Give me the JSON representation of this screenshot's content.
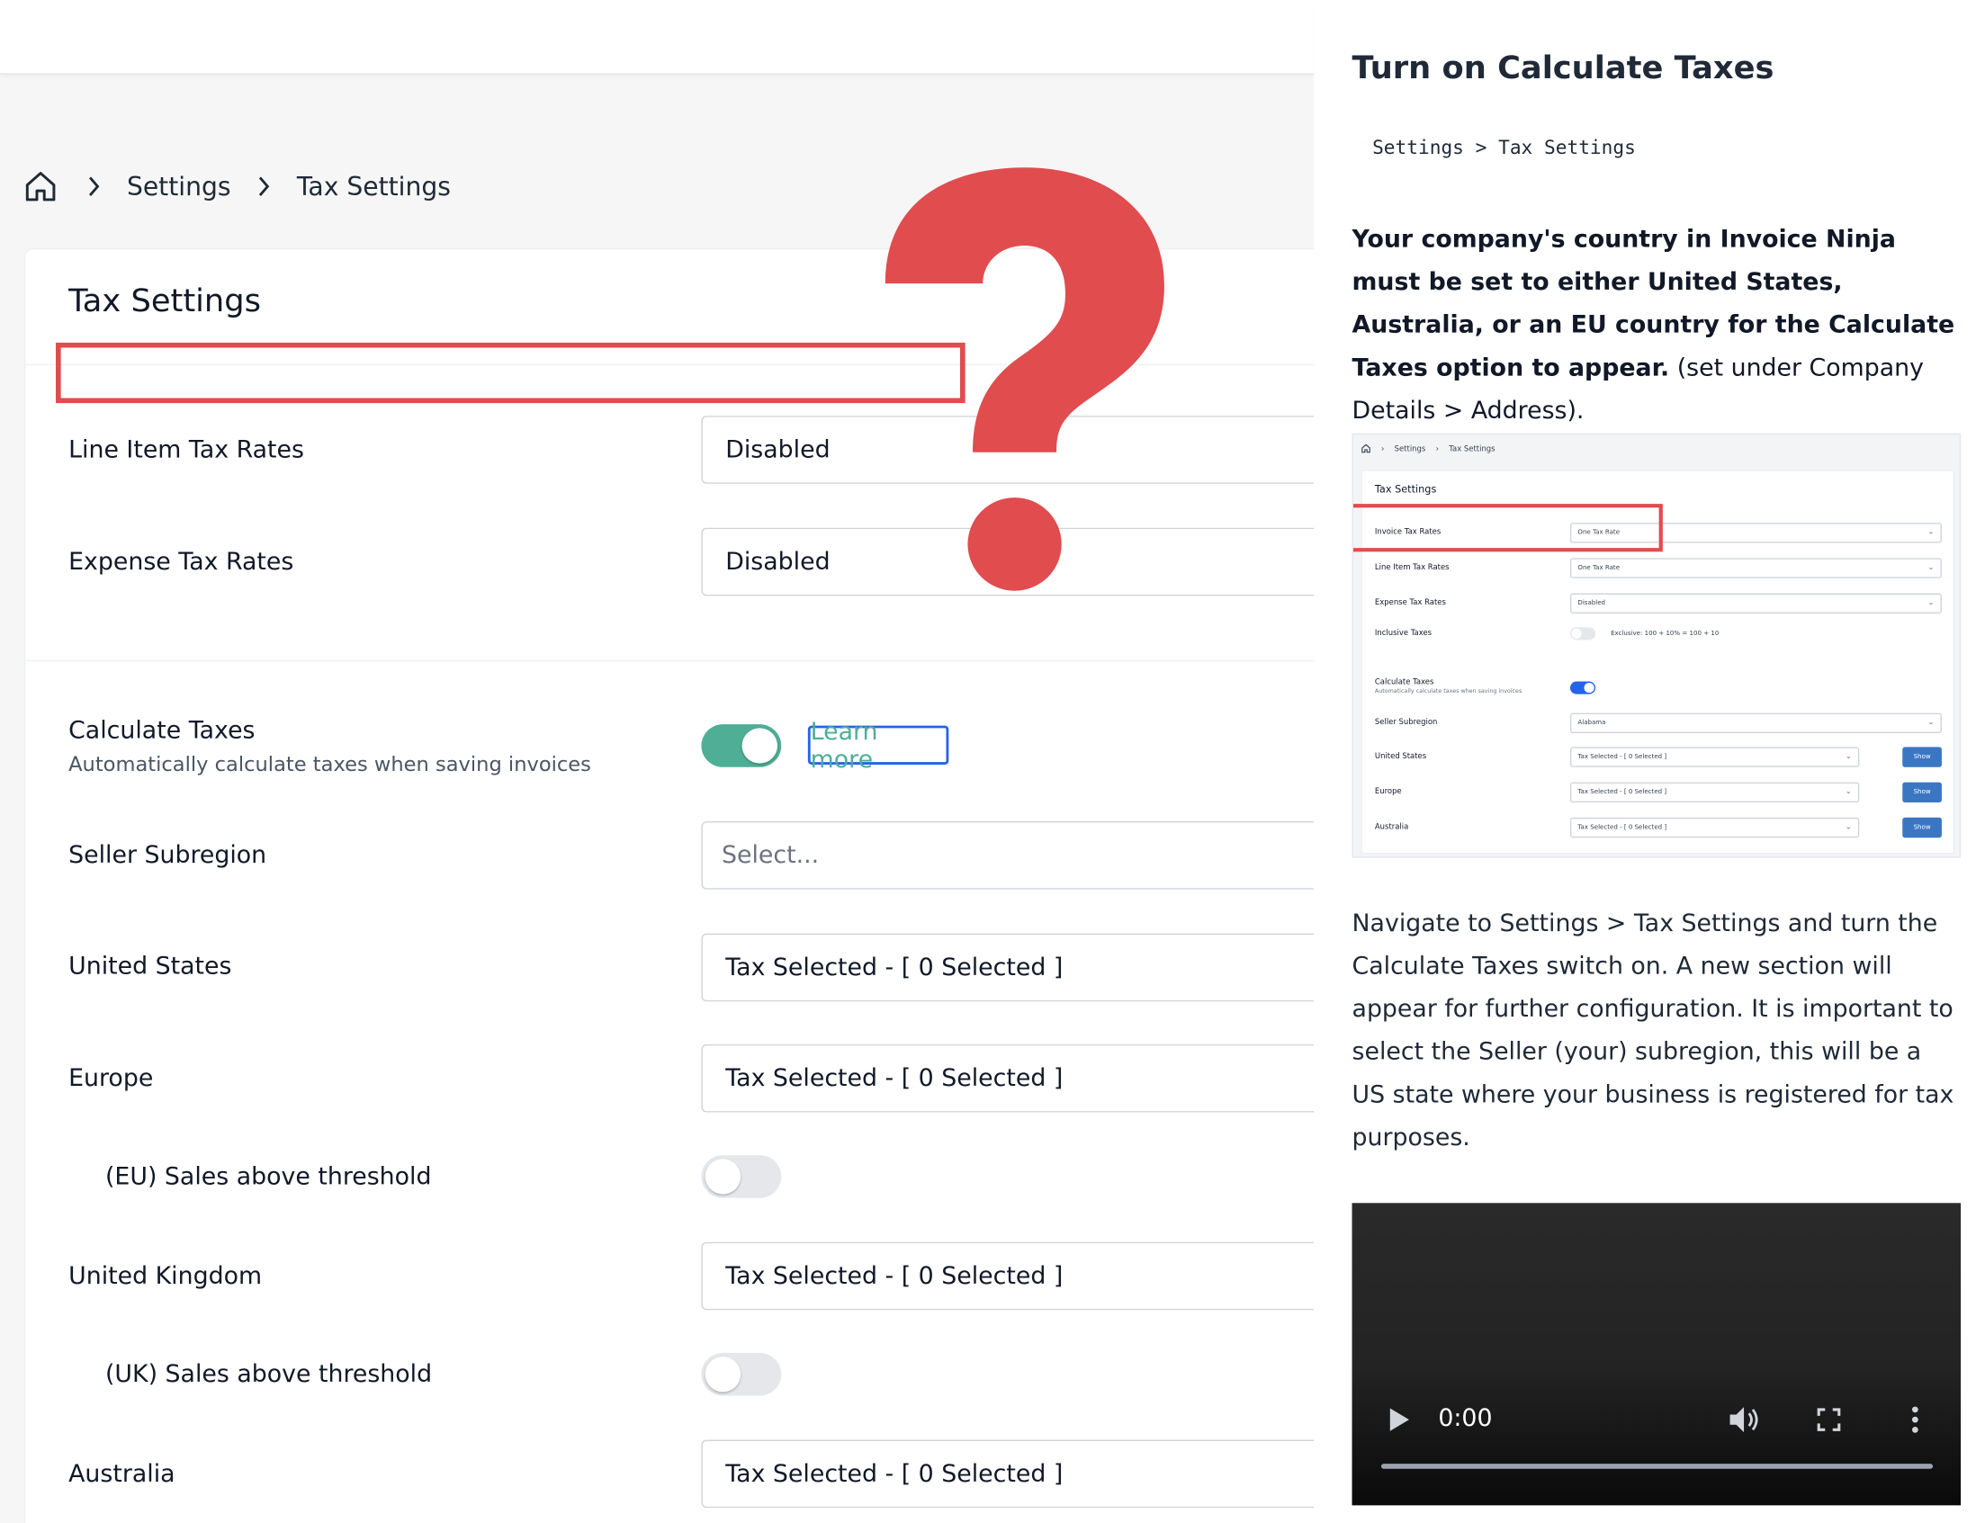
{
  "breadcrumb": {
    "items": [
      "Settings",
      "Tax Settings"
    ]
  },
  "card": {
    "title": "Tax Settings",
    "rows": {
      "line_item_tax_rates": {
        "label": "Line Item Tax Rates",
        "value": "Disabled"
      },
      "expense_tax_rates": {
        "label": "Expense Tax Rates",
        "value": "Disabled"
      },
      "calculate_taxes": {
        "label": "Calculate Taxes",
        "sublabel": "Automatically calculate taxes when saving invoices",
        "enabled": true,
        "learn_more": "Learn more"
      },
      "seller_subregion": {
        "label": "Seller Subregion",
        "placeholder": "Select..."
      },
      "united_states": {
        "label": "United States",
        "value": "Tax Selected - [ 0 Selected ]"
      },
      "europe": {
        "label": "Europe",
        "value": "Tax Selected - [ 0 Selected ]"
      },
      "eu_threshold": {
        "label": "(EU) Sales above threshold",
        "enabled": false
      },
      "united_kingdom": {
        "label": "United Kingdom",
        "value": "Tax Selected - [ 0 Selected ]"
      },
      "uk_threshold": {
        "label": "(UK) Sales above threshold",
        "enabled": false
      },
      "australia": {
        "label": "Australia",
        "value": "Tax Selected - [ 0 Selected ]"
      }
    }
  },
  "overlay": {
    "question_mark_color": "#e14c4f"
  },
  "docs": {
    "heading": "Turn on Calculate Taxes",
    "path": "Settings > Tax Settings",
    "note_bold": "Your company's country in Invoice Ninja must be set to either United States, Australia, or an EU country for the Calculate Taxes option to appear.",
    "note_rest": "(set under Company Details > Address).",
    "paragraph": "Navigate to Settings > Tax Settings and turn the Calculate Taxes switch on. A new section will appear for further configuration. It is important to select the Seller (your) subregion, this will be a US state where your business is registered for tax purposes.",
    "screenshot": {
      "breadcrumb": [
        "Settings",
        "Tax Settings"
      ],
      "title": "Tax Settings",
      "rows": {
        "invoice_tax_rates": {
          "label": "Invoice Tax Rates",
          "value": "One Tax Rate"
        },
        "line_item_tax_rates": {
          "label": "Line Item Tax Rates",
          "value": "One Tax Rate"
        },
        "expense_tax_rates": {
          "label": "Expense Tax Rates",
          "value": "Disabled"
        },
        "inclusive_taxes": {
          "label": "Inclusive Taxes",
          "note": "Exclusive: 100 + 10% = 100 + 10"
        },
        "calculate_taxes": {
          "label": "Calculate Taxes",
          "sublabel": "Automatically calculate taxes when saving invoices"
        },
        "seller_subregion": {
          "label": "Seller Subregion",
          "value": "Alabama"
        },
        "united_states": {
          "label": "United States",
          "value": "Tax Selected - [ 0 Selected ]",
          "button": "Show"
        },
        "europe": {
          "label": "Europe",
          "value": "Tax Selected - [ 0 Selected ]",
          "button": "Show"
        },
        "australia": {
          "label": "Australia",
          "value": "Tax Selected - [ 0 Selected ]",
          "button": "Show"
        }
      }
    },
    "video": {
      "time": "0:00"
    }
  },
  "colors": {
    "accent_green": "#4fae96",
    "link_border": "#2563eb",
    "highlight_red": "#e14c4f",
    "show_button": "#3b76c3"
  },
  "icons": [
    "home-icon",
    "chevron-right-icon",
    "chevron-down-icon",
    "play-icon",
    "volume-icon",
    "fullscreen-icon",
    "more-vertical-icon"
  ]
}
